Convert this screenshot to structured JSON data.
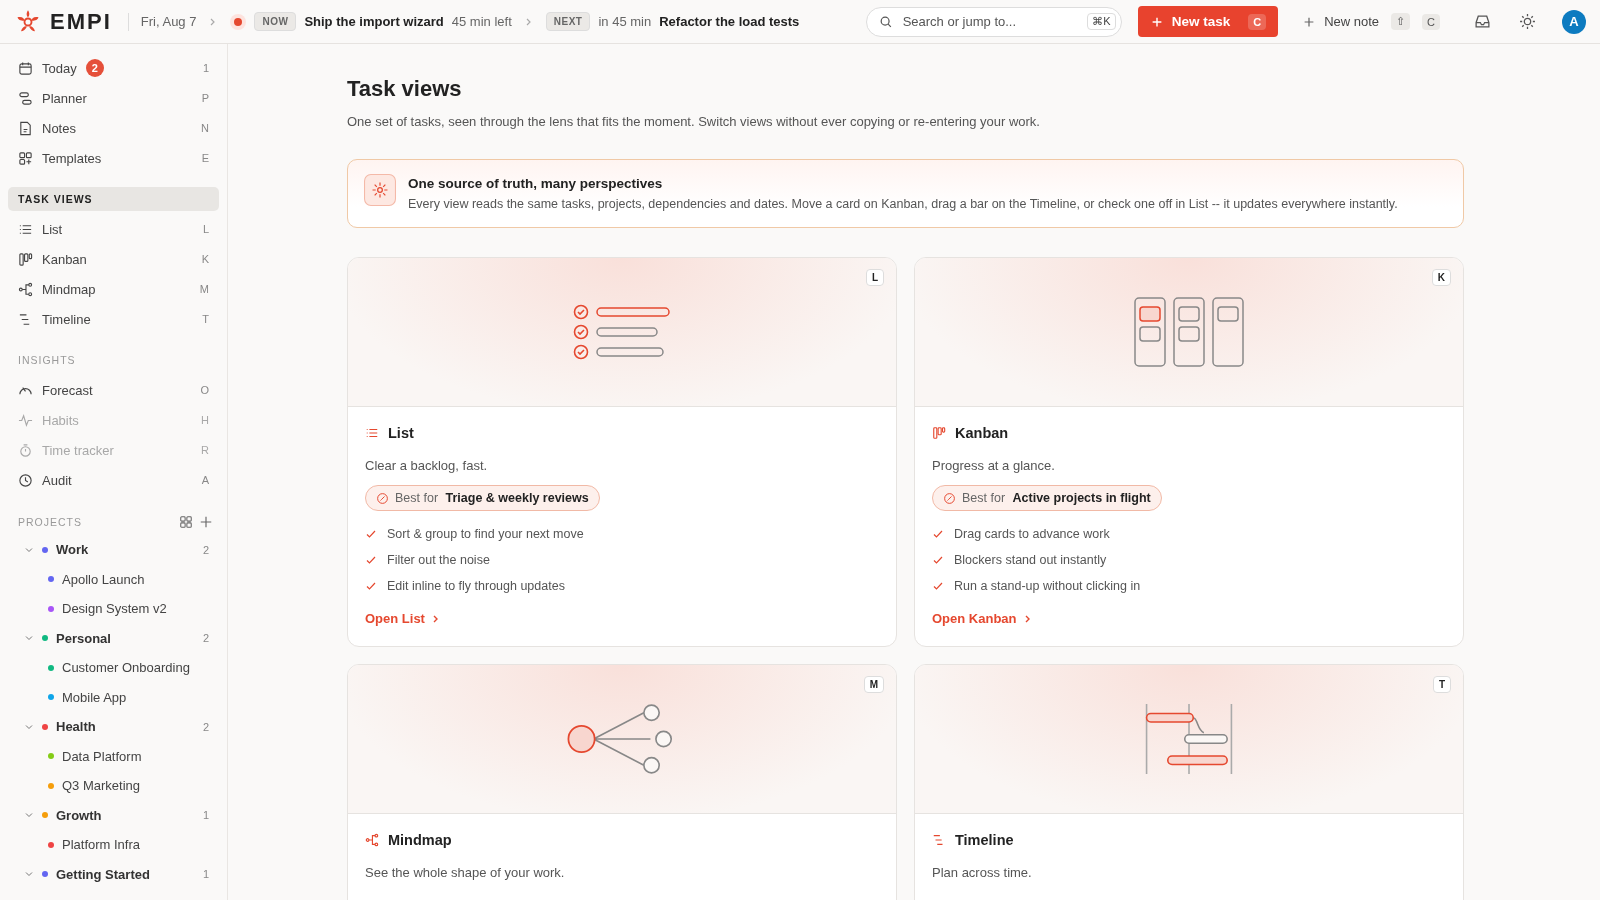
{
  "topbar": {
    "brand": "EMPI",
    "date": "Fri, Aug 7",
    "now": {
      "badge": "NOW",
      "title": "Ship the import wizard",
      "time": "45 min left"
    },
    "next": {
      "badge": "NEXT",
      "time": "in 45 min",
      "title": "Refactor the load tests"
    },
    "search": {
      "placeholder": "Search or jump to...",
      "shortcut": "⌘K"
    },
    "new_task": {
      "label": "New task",
      "shortcut": "C"
    },
    "new_note": {
      "label": "New note",
      "shortcuts": [
        "⇧",
        "C"
      ]
    },
    "avatar": "A"
  },
  "sidebar": {
    "sections": [
      {
        "items": [
          {
            "kind": "today",
            "label": "Today",
            "badge": "2",
            "key": "1",
            "disabled": false
          },
          {
            "kind": "planner",
            "label": "Planner",
            "key": "P",
            "disabled": false
          },
          {
            "kind": "notes",
            "label": "Notes",
            "key": "N",
            "disabled": false
          },
          {
            "kind": "templates",
            "label": "Templates",
            "key": "E",
            "disabled": false
          }
        ]
      },
      {
        "title": "TASK VIEWS",
        "selected": true,
        "items": [
          {
            "kind": "list",
            "label": "List",
            "key": "L",
            "disabled": false
          },
          {
            "kind": "kanban",
            "label": "Kanban",
            "key": "K",
            "disabled": false
          },
          {
            "kind": "mindmap",
            "label": "Mindmap",
            "key": "M",
            "disabled": false
          },
          {
            "kind": "timeline",
            "label": "Timeline",
            "key": "T",
            "disabled": false
          }
        ]
      },
      {
        "title": "INSIGHTS",
        "selected": false,
        "items": [
          {
            "kind": "forecast",
            "label": "Forecast",
            "key": "O",
            "disabled": false
          },
          {
            "kind": "habits",
            "label": "Habits",
            "key": "H",
            "disabled": true
          },
          {
            "kind": "timer",
            "label": "Time tracker",
            "key": "R",
            "disabled": true
          },
          {
            "kind": "audit",
            "label": "Audit",
            "key": "A",
            "disabled": false
          }
        ]
      }
    ],
    "projects": {
      "title": "PROJECTS",
      "items": [
        {
          "label": "Work",
          "color": "#6366f1",
          "count": "2",
          "expanded": true,
          "children": [
            {
              "label": "Apollo Launch",
              "color": "#6366f1"
            },
            {
              "label": "Design System v2",
              "color": "#a855f7"
            }
          ]
        },
        {
          "label": "Personal",
          "color": "#10b981",
          "count": "2",
          "expanded": true,
          "children": [
            {
              "label": "Customer Onboarding",
              "color": "#10b981"
            },
            {
              "label": "Mobile App",
              "color": "#0ea5e9"
            }
          ]
        },
        {
          "label": "Health",
          "color": "#ef4444",
          "count": "2",
          "expanded": true,
          "children": [
            {
              "label": "Data Platform",
              "color": "#84cc16"
            },
            {
              "label": "Q3 Marketing",
              "color": "#f59e0b"
            }
          ]
        },
        {
          "label": "Growth",
          "color": "#f59e0b",
          "count": "1",
          "expanded": true,
          "children": [
            {
              "label": "Platform Infra",
              "color": "#ef4444"
            }
          ]
        },
        {
          "label": "Getting Started",
          "color": "#6366f1",
          "count": "1",
          "expanded": true
        }
      ]
    }
  },
  "main": {
    "title": "Task views",
    "subtitle": "One set of tasks, seen through the lens that fits the moment. Switch views without ever copying or re-entering your work.",
    "callout": {
      "title": "One source of truth, many perspectives",
      "text": "Every view reads the same tasks, projects, dependencies and dates. Move a card on Kanban, drag a bar on the Timeline, or check one off in List -- it updates everywhere instantly."
    },
    "cards": [
      {
        "kind": "list",
        "key": "L",
        "title": "List",
        "description": "Clear a backlog, fast.",
        "best_for_label": "Best for",
        "best_for": "Triage & weekly reviews",
        "features": [
          "Sort & group to find your next move",
          "Filter out the noise",
          "Edit inline to fly through updates"
        ],
        "link": "Open List"
      },
      {
        "kind": "kanban",
        "key": "K",
        "title": "Kanban",
        "description": "Progress at a glance.",
        "best_for_label": "Best for",
        "best_for": "Active projects in flight",
        "features": [
          "Drag cards to advance work",
          "Blockers stand out instantly",
          "Run a stand-up without clicking in"
        ],
        "link": "Open Kanban"
      },
      {
        "kind": "mindmap",
        "key": "M",
        "title": "Mindmap",
        "description": "See the whole shape of your work."
      },
      {
        "kind": "timeline",
        "key": "T",
        "title": "Timeline",
        "description": "Plan across time."
      }
    ]
  }
}
